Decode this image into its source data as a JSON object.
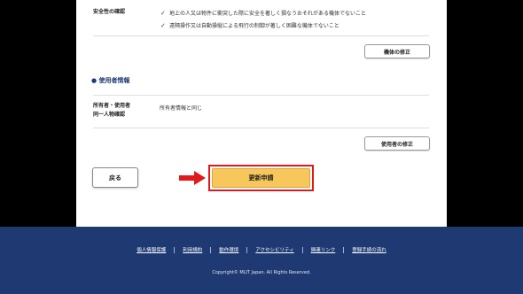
{
  "safety": {
    "label": "安全性の確認",
    "checks": [
      "地上の人又は物件に衝突した際に安全を著しく損なうおそれがある機体でないこと",
      "遠隔操作又は自動操縦による飛行の制御が著しく困難な機体でないこと"
    ]
  },
  "aircraft_edit_button": "機体の修正",
  "user_section": {
    "title": "使用者情報",
    "label_line1": "所有者・使用者",
    "label_line2": "同一人物確認",
    "value": "所有者情報と同じ"
  },
  "user_edit_button": "使用者の修正",
  "back_button": "戻る",
  "renew_button": "更新申請",
  "footer": {
    "links": [
      "個人情報保護",
      "利用規約",
      "動作環境",
      "アクセシビリティ",
      "関連リンク",
      "登録手続の流れ"
    ],
    "copyright": "Copyright© MLIT Japan. All Rights Reserved."
  },
  "colors": {
    "navy": "#1f3a73",
    "accent_yellow": "#f7c75c",
    "highlight_red": "#e01a1a"
  }
}
